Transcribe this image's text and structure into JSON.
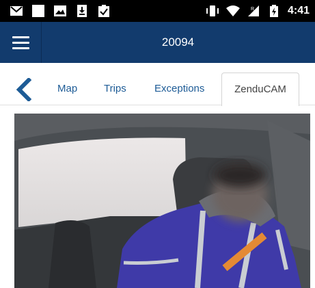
{
  "status_bar": {
    "time": "4:41",
    "icons": [
      "gmail-icon",
      "notification-square-icon",
      "image-icon",
      "download-icon",
      "clipboard-check-icon",
      "vibrate-icon",
      "wifi-icon",
      "cell-signal-icon",
      "battery-icon"
    ]
  },
  "app_bar": {
    "title": "20094",
    "menu_icon": "menu-icon",
    "color": "#123b6d"
  },
  "tabs": [
    {
      "label": "Map",
      "active": false
    },
    {
      "label": "Trips",
      "active": false
    },
    {
      "label": "Exceptions",
      "active": false
    },
    {
      "label": "ZenduCAM",
      "active": true
    }
  ],
  "back_icon": "chevron-left-icon",
  "camera": {
    "content": "camera-snapshot",
    "face_blurred": true
  }
}
